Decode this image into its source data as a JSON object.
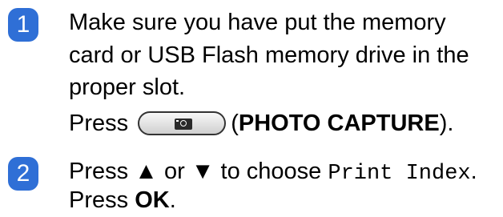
{
  "steps": [
    {
      "number": "1",
      "lines": [
        "Make sure you have put the memory",
        "card or USB Flash memory drive in the",
        "proper slot."
      ],
      "press_prefix": "Press",
      "button_icon": "camera-icon",
      "press_paren_open": "(",
      "press_bold": "PHOTO CAPTURE",
      "press_paren_close": ")."
    },
    {
      "number": "2",
      "line1_prefix": "Press ▲ or ▼ to choose ",
      "line1_mono": "Print Index",
      "line1_suffix": ".",
      "line2_prefix": "Press ",
      "line2_bold": "OK",
      "line2_suffix": "."
    }
  ]
}
